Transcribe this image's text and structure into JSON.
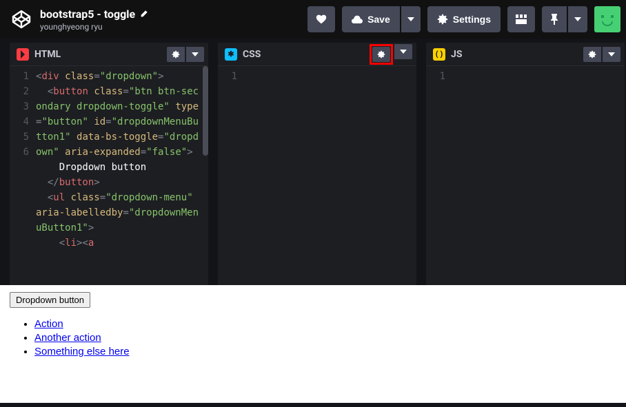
{
  "header": {
    "title": "bootstrap5 - toggle",
    "author": "younghyeong ryu",
    "save_label": "Save",
    "settings_label": "Settings"
  },
  "editors": {
    "html": {
      "title": "HTML",
      "gutter": [
        "1",
        "2",
        "3",
        "4",
        "5",
        "6"
      ],
      "lines": [
        [
          {
            "t": "pnc",
            "v": "<"
          },
          {
            "t": "tag",
            "v": "div"
          },
          {
            "t": "txt",
            "v": " "
          },
          {
            "t": "attr",
            "v": "class"
          },
          {
            "t": "pnc",
            "v": "="
          },
          {
            "t": "str",
            "v": "\"dropdown\""
          },
          {
            "t": "pnc",
            "v": ">"
          }
        ],
        [
          {
            "t": "txt",
            "v": "  "
          },
          {
            "t": "pnc",
            "v": "<"
          },
          {
            "t": "tag",
            "v": "button"
          },
          {
            "t": "txt",
            "v": " "
          },
          {
            "t": "attr",
            "v": "class"
          },
          {
            "t": "pnc",
            "v": "="
          },
          {
            "t": "str",
            "v": "\"btn btn-secondary dropdown-toggle\""
          },
          {
            "t": "txt",
            "v": " "
          },
          {
            "t": "attr",
            "v": "type"
          },
          {
            "t": "pnc",
            "v": "="
          },
          {
            "t": "str",
            "v": "\"button\""
          },
          {
            "t": "txt",
            "v": " "
          },
          {
            "t": "attr",
            "v": "id"
          },
          {
            "t": "pnc",
            "v": "="
          },
          {
            "t": "str",
            "v": "\"dropdownMenuButton1\""
          },
          {
            "t": "txt",
            "v": " "
          },
          {
            "t": "attr",
            "v": "data-bs-toggle"
          },
          {
            "t": "pnc",
            "v": "="
          },
          {
            "t": "str",
            "v": "\"dropdown\""
          },
          {
            "t": "txt",
            "v": " "
          },
          {
            "t": "attr",
            "v": "aria-expanded"
          },
          {
            "t": "pnc",
            "v": "="
          },
          {
            "t": "str",
            "v": "\"false\""
          },
          {
            "t": "pnc",
            "v": ">"
          }
        ],
        [
          {
            "t": "txt",
            "v": "    Dropdown button"
          }
        ],
        [
          {
            "t": "txt",
            "v": "  "
          },
          {
            "t": "pnc",
            "v": "</"
          },
          {
            "t": "tag",
            "v": "button"
          },
          {
            "t": "pnc",
            "v": ">"
          }
        ],
        [
          {
            "t": "txt",
            "v": "  "
          },
          {
            "t": "pnc",
            "v": "<"
          },
          {
            "t": "tag",
            "v": "ul"
          },
          {
            "t": "txt",
            "v": " "
          },
          {
            "t": "attr",
            "v": "class"
          },
          {
            "t": "pnc",
            "v": "="
          },
          {
            "t": "str",
            "v": "\"dropdown-menu\""
          },
          {
            "t": "txt",
            "v": " "
          },
          {
            "t": "attr",
            "v": "aria-labelledby"
          },
          {
            "t": "pnc",
            "v": "="
          },
          {
            "t": "str",
            "v": "\"dropdownMenuButton1\""
          },
          {
            "t": "pnc",
            "v": ">"
          }
        ],
        [
          {
            "t": "txt",
            "v": "    "
          },
          {
            "t": "pnc",
            "v": "<"
          },
          {
            "t": "tag",
            "v": "li"
          },
          {
            "t": "pnc",
            "v": "><"
          },
          {
            "t": "tag",
            "v": "a"
          }
        ]
      ]
    },
    "css": {
      "title": "CSS",
      "gutter": [
        "1"
      ]
    },
    "js": {
      "title": "JS",
      "gutter": [
        "1"
      ]
    }
  },
  "preview": {
    "button_label": "Dropdown button",
    "items": [
      "Action",
      "Another action",
      "Something else here"
    ]
  }
}
